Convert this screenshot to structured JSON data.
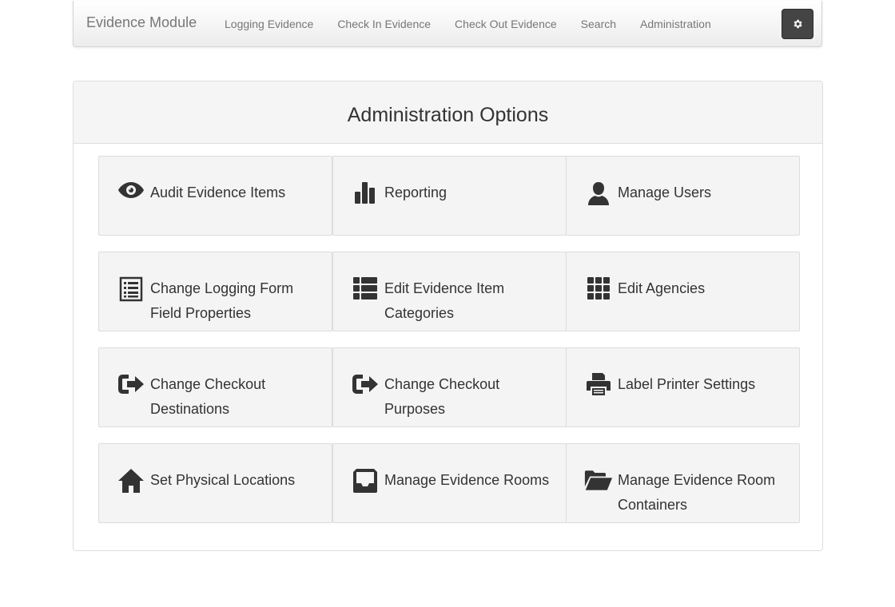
{
  "navbar": {
    "brand": "Evidence Module",
    "links": [
      {
        "label": "Logging Evidence"
      },
      {
        "label": "Check In Evidence"
      },
      {
        "label": "Check Out Evidence"
      },
      {
        "label": "Search"
      },
      {
        "label": "Administration"
      }
    ],
    "settings_icon": "gear-icon"
  },
  "panel": {
    "title": "Administration Options",
    "tiles": [
      {
        "label": "Audit Evidence Items",
        "icon": "eye-icon"
      },
      {
        "label": "Reporting",
        "icon": "bar-chart-icon"
      },
      {
        "label": "Manage Users",
        "icon": "user-icon"
      },
      {
        "label": "Change Logging Form Field Properties",
        "icon": "list-alt-icon"
      },
      {
        "label": "Edit Evidence Item Categories",
        "icon": "th-list-icon"
      },
      {
        "label": "Edit Agencies",
        "icon": "th-icon"
      },
      {
        "label": "Change Checkout Destinations",
        "icon": "log-out-icon"
      },
      {
        "label": "Change Checkout Purposes",
        "icon": "log-out-icon"
      },
      {
        "label": "Label Printer Settings",
        "icon": "print-icon"
      },
      {
        "label": "Set Physical Locations",
        "icon": "home-icon"
      },
      {
        "label": "Manage Evidence Rooms",
        "icon": "inbox-icon"
      },
      {
        "label": "Manage Evidence Room Containers",
        "icon": "folder-open-icon"
      }
    ]
  },
  "colors": {
    "navbar_text": "#777777",
    "tile_bg": "#f4f4f4",
    "icon": "#333333",
    "gear_button": "#444444"
  }
}
